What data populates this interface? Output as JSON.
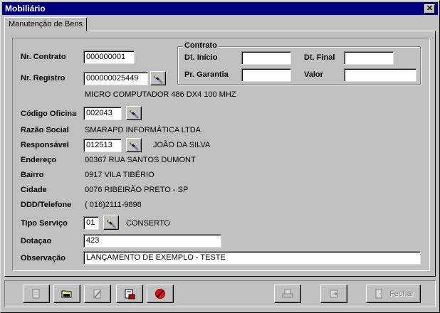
{
  "window": {
    "title": "Mobiliário",
    "close_glyph": "✕"
  },
  "tab": {
    "label": "Manutenção de Bens"
  },
  "form": {
    "nr_contrato": {
      "label": "Nr. Contrato",
      "value": "000000001"
    },
    "nr_registro": {
      "label": "Nr. Registro",
      "value": "000000025449",
      "description": "MICRO COMPUTADOR 486 DX4 100 MHZ"
    },
    "codigo_oficina": {
      "label": "Código Oficina",
      "value": "002043"
    },
    "razao_social": {
      "label": "Razão Social",
      "value": "SMARAPD INFORMÁTICA LTDA."
    },
    "responsavel": {
      "label": "Responsável",
      "value": "012513",
      "name": "JOÃO DA SILVA"
    },
    "endereco": {
      "label": "Endereço",
      "value": "00367 RUA  SANTOS DUMONT"
    },
    "bairro": {
      "label": "Bairro",
      "value": "0917 VILA TIBÉRIO"
    },
    "cidade": {
      "label": "Cidade",
      "value": "0076 RIBEIRÃO PRETO - SP"
    },
    "ddd_telefone": {
      "label": "DDD/Telefone",
      "value": "( 016)2111-9898"
    },
    "tipo_servico": {
      "label": "Tipo Serviço",
      "value": "01",
      "description": "CONSERTO"
    },
    "dotacao": {
      "label": "Dotaçao",
      "value": "423"
    },
    "observacao": {
      "label": "Observação",
      "value": "LANÇAMENTO DE EXEMPLO - TESTE"
    }
  },
  "contrato": {
    "title": "Contrato",
    "dt_inicio": {
      "label": "Dt. Início",
      "value": ""
    },
    "dt_final": {
      "label": "Dt. Final",
      "value": ""
    },
    "pr_garantia": {
      "label": "Pr. Garantia",
      "value": ""
    },
    "valor": {
      "label": "Valor",
      "value": ""
    }
  },
  "toolbar": {
    "fechar_label": "Fechar",
    "buttons": [
      "new-record",
      "open-folder",
      "edit-record",
      "save-record",
      "cancel",
      "print",
      "export",
      "close"
    ]
  }
}
